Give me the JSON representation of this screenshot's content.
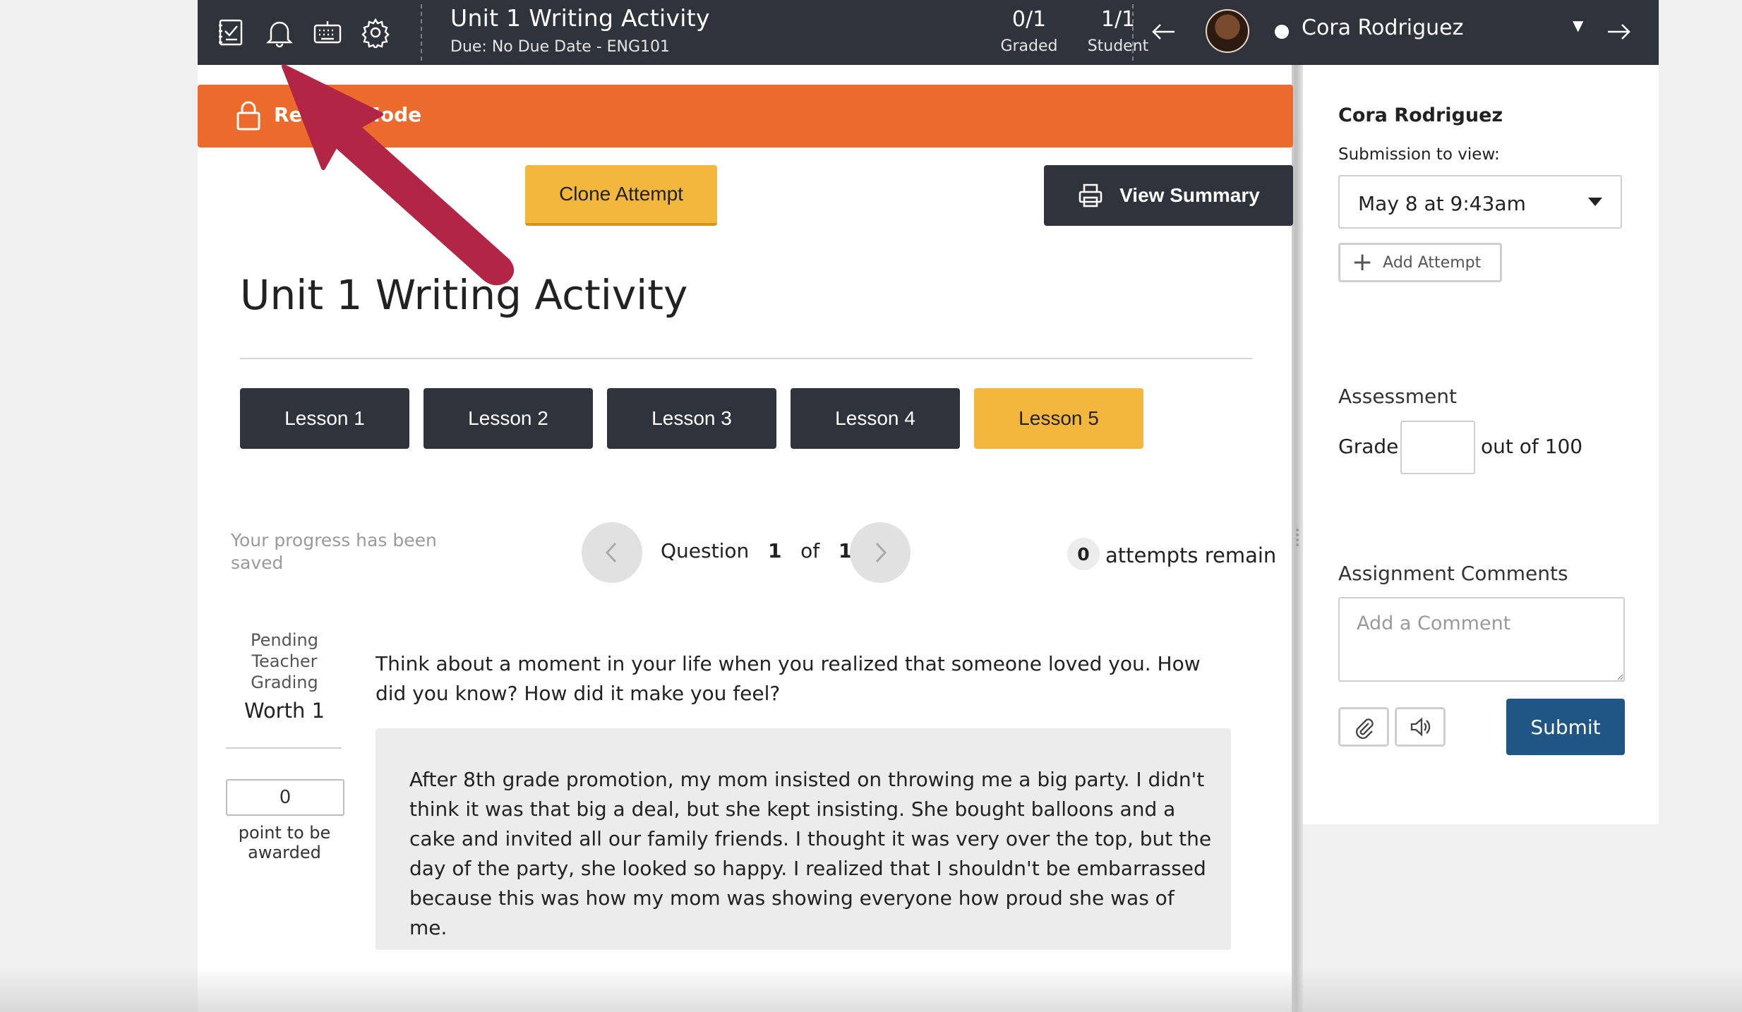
{
  "topbar": {
    "icons": [
      "checklist-icon",
      "bell-icon",
      "keyboard-icon",
      "gear-icon"
    ],
    "title": "Unit 1 Writing Activity",
    "subtitle": "Due: No Due Date - ENG101",
    "graded": {
      "value": "0/1",
      "label": "Graded"
    },
    "student": {
      "value": "1/1",
      "label": "Student"
    },
    "user_name": "Cora Rodriguez",
    "caret": "▼"
  },
  "banner": {
    "text": "Review Mode"
  },
  "actions": {
    "clone_label": "Clone Attempt",
    "summary_label": "View Summary"
  },
  "page_title": "Unit 1 Writing Activity",
  "lessons": [
    {
      "label": "Lesson 1",
      "active": false
    },
    {
      "label": "Lesson 2",
      "active": false
    },
    {
      "label": "Lesson 3",
      "active": false
    },
    {
      "label": "Lesson 4",
      "active": false
    },
    {
      "label": "Lesson 5",
      "active": true
    }
  ],
  "progress": {
    "saved_text": "Your progress has been saved",
    "question_word": "Question",
    "current": "1",
    "of_word": "of",
    "total": "1",
    "attempts_count": "0",
    "attempts_text": "attempts remain"
  },
  "grading": {
    "status": "Pending Teacher Grading",
    "worth": "Worth 1",
    "points_value": "0",
    "points_label": "point to be awarded"
  },
  "question": {
    "prompt": "Think about a moment in your life when you realized that someone loved you. How did you know? How did it make you feel?",
    "answer": "After 8th grade promotion, my mom insisted on throwing me a big party. I didn't think it was that big a deal, but she kept insisting. She bought balloons and a cake and invited all our family friends. I thought it was very over the top, but the day of the party, she looked so happy. I realized that I shouldn't be embarrassed because this was how my mom was showing everyone how proud she was of me."
  },
  "panel": {
    "student_name": "Cora Rodriguez",
    "submission_label": "Submission to view:",
    "submission_value": "May 8 at 9:43am",
    "add_attempt_label": "Add Attempt",
    "assessment_label": "Assessment",
    "grade_label": "Grade",
    "grade_value": "",
    "out_of_label": "out of 100",
    "comments_label": "Assignment Comments",
    "comment_placeholder": "Add a Comment",
    "submit_label": "Submit"
  },
  "colors": {
    "topbar": "#2f333b",
    "banner": "#eb6a2c",
    "accent_yellow": "#f3b73e",
    "submit_blue": "#1f5685",
    "annotation_arrow": "#b22545"
  }
}
